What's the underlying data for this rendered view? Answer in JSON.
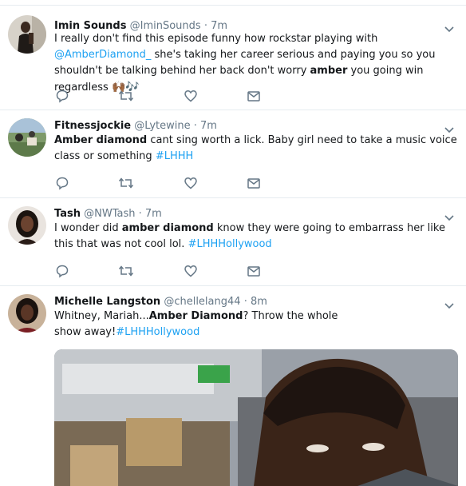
{
  "tweets": [
    {
      "name": "Imin Sounds",
      "handle": "@IminSounds",
      "separator": "·",
      "time": "7m",
      "text_1": "I really don't find this episode funny how rockstar playing with",
      "mention": "@AmberDiamond_",
      "text_2": "she's taking her career serious and paying you so you shouldn't be talking behind her back  don't worry",
      "bold": "amber",
      "text_3": "you going win regardless",
      "emoji": "🙌🏾🎶"
    },
    {
      "name": "Fitnessjockie",
      "handle": "@Lytewine",
      "separator": "·",
      "time": "7m",
      "bold": "Amber diamond",
      "text_1": "cant sing worth a lick. Baby girl need to take a music voice class or something",
      "hashtag": "#LHHH"
    },
    {
      "name": "Tash",
      "handle": "@NWTash",
      "separator": "·",
      "time": "7m",
      "text_1": "I wonder did",
      "bold": "amber diamond",
      "text_2": "know they were going to embarrass her like this that was not cool lol.",
      "hashtag": "#LHHHollywood"
    },
    {
      "name": "Michelle Langston",
      "handle": "@chellelang44",
      "separator": "·",
      "time": "8m",
      "text_1": "Whitney, Mariah...",
      "bold": "Amber Diamond",
      "text_2": "?  Throw the whole show away!",
      "hashtag": "#LHHHollywood"
    }
  ],
  "icons": {
    "reply": "reply-icon",
    "retweet": "retweet-icon",
    "like": "heart-icon",
    "dm": "envelope-icon",
    "more": "chevron-down-icon"
  },
  "colors": {
    "link": "#1da1f2",
    "secondary": "#657786",
    "text": "#14171a",
    "border": "#e6ecf0"
  }
}
